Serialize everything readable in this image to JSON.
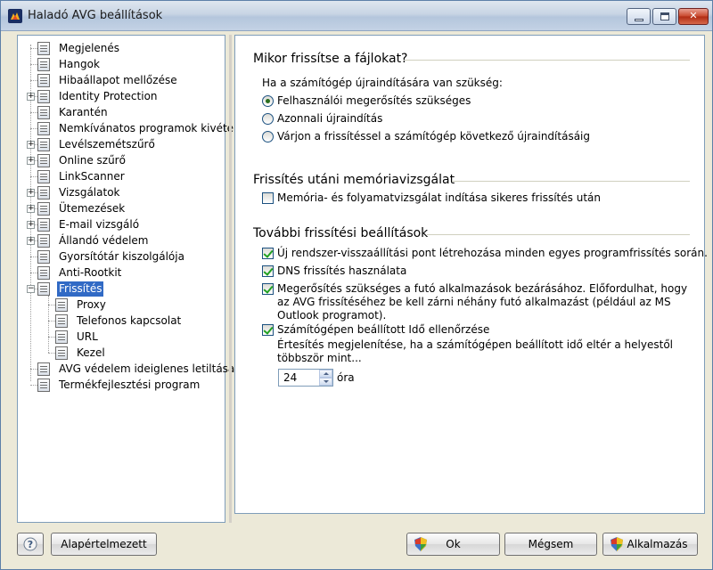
{
  "window": {
    "title": "Haladó AVG beállítások"
  },
  "tree": {
    "items": [
      {
        "label": "Megjelenés",
        "level": 1,
        "expandable": false
      },
      {
        "label": "Hangok",
        "level": 1,
        "expandable": false
      },
      {
        "label": "Hibaállapot mellőzése",
        "level": 1,
        "expandable": false
      },
      {
        "label": "Identity Protection",
        "level": 1,
        "expandable": true
      },
      {
        "label": "Karantén",
        "level": 1,
        "expandable": false
      },
      {
        "label": "Nemkívánatos programok kivételei",
        "level": 1,
        "expandable": false
      },
      {
        "label": "Levélszemétszűrő",
        "level": 1,
        "expandable": true
      },
      {
        "label": "Online szűrő",
        "level": 1,
        "expandable": true
      },
      {
        "label": "LinkScanner",
        "level": 1,
        "expandable": false
      },
      {
        "label": "Vizsgálatok",
        "level": 1,
        "expandable": true
      },
      {
        "label": "Ütemezések",
        "level": 1,
        "expandable": true
      },
      {
        "label": "E-mail vizsgáló",
        "level": 1,
        "expandable": true
      },
      {
        "label": "Állandó védelem",
        "level": 1,
        "expandable": true
      },
      {
        "label": "Gyorsítótár kiszolgálója",
        "level": 1,
        "expandable": false
      },
      {
        "label": "Anti-Rootkit",
        "level": 1,
        "expandable": false
      },
      {
        "label": "Frissítés",
        "level": 1,
        "expandable": true,
        "expanded": true,
        "selected": true
      },
      {
        "label": "Proxy",
        "level": 2,
        "expandable": false
      },
      {
        "label": "Telefonos kapcsolat",
        "level": 2,
        "expandable": false
      },
      {
        "label": "URL",
        "level": 2,
        "expandable": false
      },
      {
        "label": "Kezel",
        "level": 2,
        "expandable": false
      },
      {
        "label": "AVG védelem ideiglenes letiltása",
        "level": 1,
        "expandable": false
      },
      {
        "label": "Termékfejlesztési program",
        "level": 1,
        "expandable": false
      }
    ]
  },
  "section1": {
    "title": "Mikor frissítse a fájlokat?",
    "prompt": "Ha a számítógép újraindítására van szükség:",
    "options": [
      {
        "label": "Felhasználói megerősítés szükséges",
        "checked": true
      },
      {
        "label": "Azonnali újraindítás",
        "checked": false
      },
      {
        "label": "Várjon a frissítéssel a számítógép következő újraindításáig",
        "checked": false
      }
    ]
  },
  "section2": {
    "title": "Frissítés utáni memóriavizsgálat",
    "checkbox": {
      "label": "Memória- és folyamatvizsgálat indítása sikeres frissítés után",
      "checked": false
    }
  },
  "section3": {
    "title": "További frissítési beállítások",
    "cb_restore": {
      "label": "Új rendszer-visszaállítási pont létrehozása minden egyes programfrissítés során.",
      "checked": true
    },
    "cb_dns": {
      "label": "DNS frissítés használata",
      "checked": true
    },
    "cb_close_apps": {
      "label": "Megerősítés szükséges a futó alkalmazások bezárásához. Előfordulhat, hogy az AVG frissítéséhez be kell zárni néhány futó alkalmazást (például az MS Outlook programot).",
      "checked": true
    },
    "cb_time": {
      "label": "Számítógépen beállított Idő ellenőrzése",
      "checked": true
    },
    "time_note": "Értesítés megjelenítése, ha a számítógépen beállított idő eltér a helyestől többször mint...",
    "hours_value": "24",
    "hours_unit": "óra"
  },
  "buttons": {
    "defaults": "Alapértelmezett",
    "ok": "Ok",
    "cancel": "Mégsem",
    "apply": "Alkalmazás"
  }
}
